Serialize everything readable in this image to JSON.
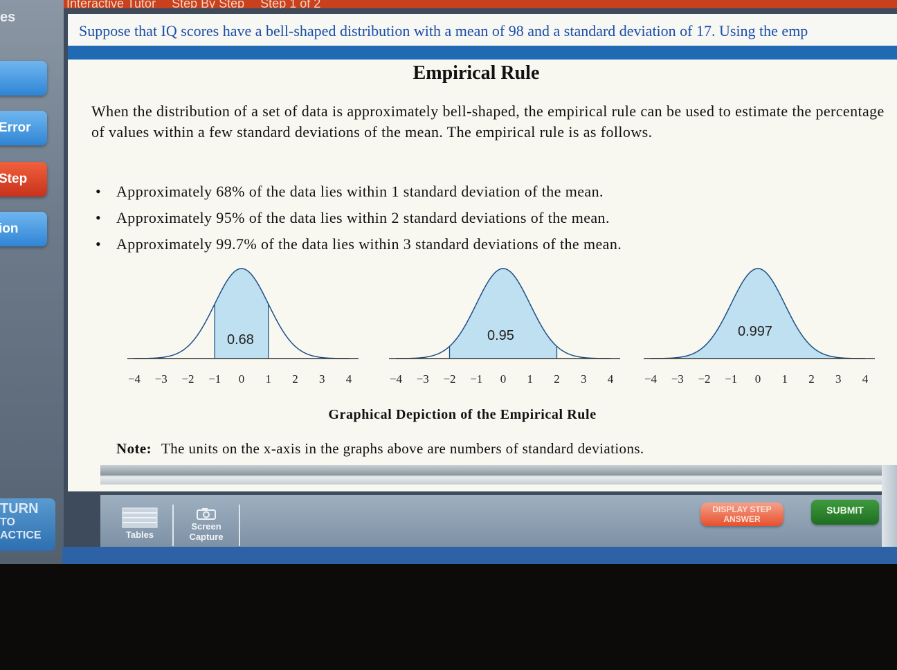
{
  "window": {
    "title_tabs": [
      "Interactive Tutor",
      "Step By Step",
      "Step 1 of 2"
    ]
  },
  "sidebar": {
    "heading": "es",
    "buttons": [
      {
        "label": ""
      },
      {
        "label": "Error"
      },
      {
        "label": "Step"
      },
      {
        "label": "ion"
      }
    ],
    "return_button": {
      "line1": "TURN",
      "line2": "TO",
      "line3": "ACTICE"
    }
  },
  "question": {
    "text": "Suppose that IQ scores have a bell-shaped distribution with a mean of 98 and a standard deviation of 17.  Using the emp"
  },
  "lesson": {
    "title": "Empirical Rule",
    "intro": "When the distribution of a set of data is approximately bell-shaped, the empirical rule can be used to estimate the percentage of values within a few standard deviations of the mean.  The empirical rule is as follows.",
    "rules": [
      "Approximately 68% of the data lies within 1 standard deviation of the mean.",
      "Approximately 95% of the data lies within 2 standard deviations of the mean.",
      "Approximately 99.7% of the data lies within 3 standard deviations of the mean."
    ],
    "graph_caption": "Graphical Depiction of the Empirical Rule",
    "note_label": "Note:",
    "note_text": "The units on the x-axis in the graphs above are numbers of standard deviations."
  },
  "graphs": [
    {
      "probability": "0.68",
      "shade_sd": 1,
      "ticks": [
        "−4",
        "−3",
        "−2",
        "−1",
        "0",
        "1",
        "2",
        "3",
        "4"
      ]
    },
    {
      "probability": "0.95",
      "shade_sd": 2,
      "ticks": [
        "−4",
        "−3",
        "−2",
        "−1",
        "0",
        "1",
        "2",
        "3",
        "4"
      ]
    },
    {
      "probability": "0.997",
      "shade_sd": 3,
      "ticks": [
        "−4",
        "−3",
        "−2",
        "−1",
        "0",
        "1",
        "2",
        "3",
        "4"
      ]
    }
  ],
  "toolbar": {
    "tables_label": "Tables",
    "screen_capture_line1": "Screen",
    "screen_capture_line2": "Capture",
    "display_step_line1": "DISPLAY STEP",
    "display_step_line2": "ANSWER",
    "submit_label": "SUBMIT"
  },
  "colors": {
    "accent_blue": "#1f6ab3",
    "question_text": "#1b4fa8",
    "curve_fill": "#bfe0f0",
    "curve_stroke": "#1e4f86",
    "submit_green": "#2f8a30",
    "display_step_orange": "#e8502c"
  },
  "icons": {
    "tables": "table-icon",
    "screen_capture": "camera-icon"
  }
}
